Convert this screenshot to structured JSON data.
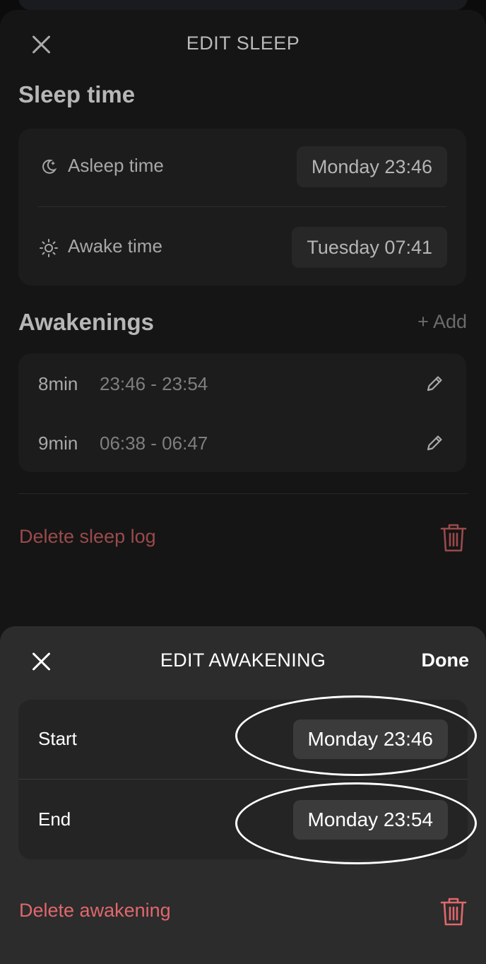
{
  "back_sheet": {
    "title": "EDIT SLEEP",
    "sleep_time": {
      "heading": "Sleep time",
      "asleep": {
        "label": "Asleep time",
        "value": "Monday 23:46",
        "icon": "moon-icon"
      },
      "awake": {
        "label": "Awake time",
        "value": "Tuesday 07:41",
        "icon": "sun-icon"
      }
    },
    "awakenings": {
      "heading": "Awakenings",
      "add_label": "+ Add",
      "items": [
        {
          "duration": "8min",
          "range": "23:46 - 23:54"
        },
        {
          "duration": "9min",
          "range": "06:38 - 06:47"
        }
      ]
    },
    "delete_label": "Delete sleep log"
  },
  "front_sheet": {
    "title": "EDIT AWAKENING",
    "done_label": "Done",
    "start": {
      "label": "Start",
      "value": "Monday 23:46"
    },
    "end": {
      "label": "End",
      "value": "Monday 23:54"
    },
    "delete_label": "Delete awakening"
  },
  "colors": {
    "danger": "#e0676d",
    "danger_dimmed": "#9a4a4d",
    "sheet_background": "#2b2c2b"
  }
}
